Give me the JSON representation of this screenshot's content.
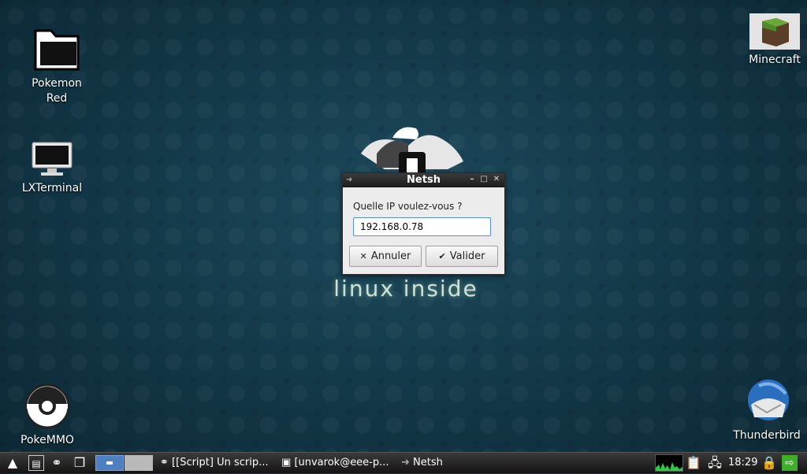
{
  "desktop": {
    "icons": [
      {
        "label": "Pokemon\nRed",
        "line1": "Pokemon",
        "line2": "Red",
        "icon": "folder-icon"
      },
      {
        "label": "LXTerminal",
        "icon": "monitor-icon"
      },
      {
        "label": "PokeMMO",
        "icon": "pokeball-icon"
      },
      {
        "label": "Minecraft",
        "icon": "grass-block-icon"
      },
      {
        "label": "Thunderbird",
        "icon": "thunderbird-icon"
      }
    ],
    "wallpaper_text": "linux inside"
  },
  "dialog": {
    "title": "Netsh",
    "prompt": "Quelle IP voulez-vous ?",
    "ip_value": "192.168.0.78",
    "cancel_label": "Annuler",
    "ok_label": "Valider"
  },
  "taskbar": {
    "tasks": [
      {
        "label": "[[Script] Un scrip...",
        "icon": "browser-icon"
      },
      {
        "label": "[unvarok@eee-p...",
        "icon": "terminal-icon"
      },
      {
        "label": "Netsh",
        "icon": "netsh-icon"
      }
    ],
    "clock": "18:29"
  },
  "colors": {
    "desktop_bg": "#123646",
    "taskbar_bg": "#1c1c1c",
    "active_desktop": "#4d7fc1",
    "field_border": "#5b8fd6"
  }
}
